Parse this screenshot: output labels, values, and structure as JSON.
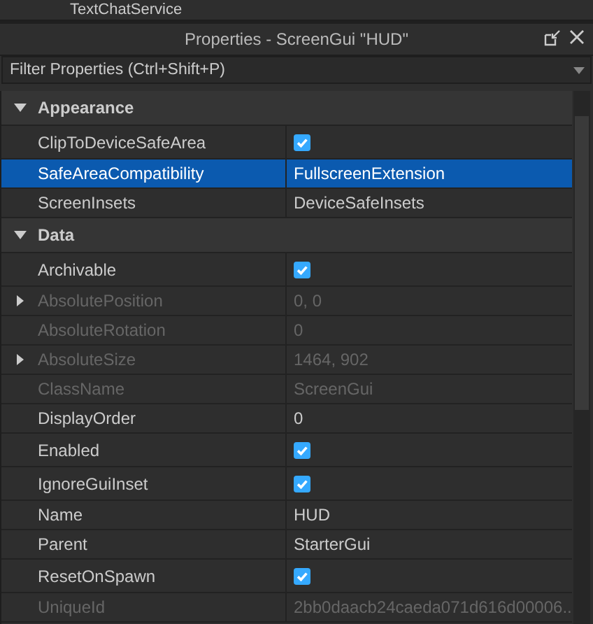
{
  "explorer_item": {
    "label": "TextChatService"
  },
  "window": {
    "title": "Properties - ScreenGui \"HUD\""
  },
  "filter": {
    "placeholder": "Filter Properties (Ctrl+Shift+P)"
  },
  "categories": [
    {
      "name": "Appearance",
      "expanded": true,
      "properties": [
        {
          "name": "ClipToDeviceSafeArea",
          "kind": "checkbox",
          "checked": true,
          "selected": false,
          "disabled": false,
          "expandable": false
        },
        {
          "name": "SafeAreaCompatibility",
          "kind": "text",
          "value": "FullscreenExtension",
          "selected": true,
          "disabled": false,
          "expandable": false
        },
        {
          "name": "ScreenInsets",
          "kind": "text",
          "value": "DeviceSafeInsets",
          "selected": false,
          "disabled": false,
          "expandable": false
        }
      ]
    },
    {
      "name": "Data",
      "expanded": true,
      "properties": [
        {
          "name": "Archivable",
          "kind": "checkbox",
          "checked": true,
          "selected": false,
          "disabled": false,
          "expandable": false
        },
        {
          "name": "AbsolutePosition",
          "kind": "text",
          "value": "0, 0",
          "selected": false,
          "disabled": true,
          "expandable": true
        },
        {
          "name": "AbsoluteRotation",
          "kind": "text",
          "value": "0",
          "selected": false,
          "disabled": true,
          "expandable": false
        },
        {
          "name": "AbsoluteSize",
          "kind": "text",
          "value": "1464, 902",
          "selected": false,
          "disabled": true,
          "expandable": true
        },
        {
          "name": "ClassName",
          "kind": "text",
          "value": "ScreenGui",
          "selected": false,
          "disabled": true,
          "expandable": false
        },
        {
          "name": "DisplayOrder",
          "kind": "text",
          "value": "0",
          "selected": false,
          "disabled": false,
          "expandable": false
        },
        {
          "name": "Enabled",
          "kind": "checkbox",
          "checked": true,
          "selected": false,
          "disabled": false,
          "expandable": false
        },
        {
          "name": "IgnoreGuiInset",
          "kind": "checkbox",
          "checked": true,
          "selected": false,
          "disabled": false,
          "expandable": false
        },
        {
          "name": "Name",
          "kind": "text",
          "value": "HUD",
          "selected": false,
          "disabled": false,
          "expandable": false
        },
        {
          "name": "Parent",
          "kind": "text",
          "value": "StarterGui",
          "selected": false,
          "disabled": false,
          "expandable": false
        },
        {
          "name": "ResetOnSpawn",
          "kind": "checkbox",
          "checked": true,
          "selected": false,
          "disabled": false,
          "expandable": false
        },
        {
          "name": "UniqueId",
          "kind": "text",
          "value": "2bb0daacb24caeda071d616d00006...",
          "selected": false,
          "disabled": true,
          "expandable": false
        }
      ]
    }
  ]
}
